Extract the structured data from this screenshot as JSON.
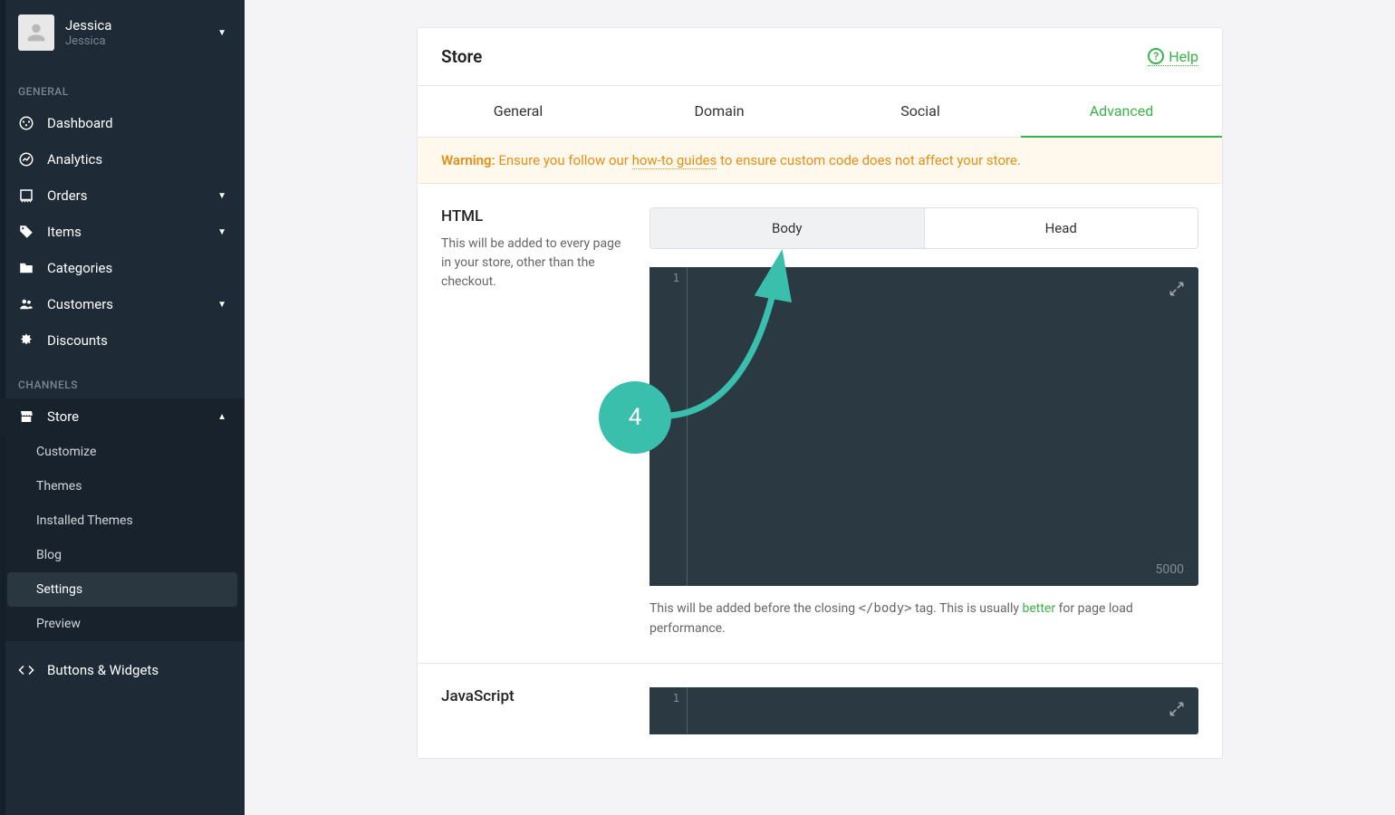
{
  "user": {
    "name": "Jessica",
    "sub": "Jessica"
  },
  "sidebar": {
    "section_general": "GENERAL",
    "section_channels": "CHANNELS",
    "items": {
      "dashboard": "Dashboard",
      "analytics": "Analytics",
      "orders": "Orders",
      "items": "Items",
      "categories": "Categories",
      "customers": "Customers",
      "discounts": "Discounts",
      "store": "Store",
      "buttons_widgets": "Buttons & Widgets"
    },
    "store_sub": {
      "customize": "Customize",
      "themes": "Themes",
      "installed_themes": "Installed Themes",
      "blog": "Blog",
      "settings": "Settings",
      "preview": "Preview"
    }
  },
  "page": {
    "title": "Store",
    "help_label": "Help",
    "tabs": {
      "general": "General",
      "domain": "Domain",
      "social": "Social",
      "advanced": "Advanced"
    },
    "warning": {
      "prefix": "Warning:",
      "before": " Ensure you follow our ",
      "link": "how-to guides",
      "after": " to ensure custom code does not affect your store."
    },
    "html_section": {
      "title": "HTML",
      "desc": "This will be added to every page in your store, other than the checkout.",
      "toggle_body": "Body",
      "toggle_head": "Head",
      "line": "1",
      "count": "5000",
      "helper_before": "This will be added before the closing ",
      "helper_tag": "</body>",
      "helper_mid": " tag. This is usually ",
      "helper_link": "better",
      "helper_after": " for page load performance."
    },
    "js_section": {
      "title": "JavaScript",
      "line": "1"
    }
  },
  "annotation": {
    "number": "4"
  }
}
